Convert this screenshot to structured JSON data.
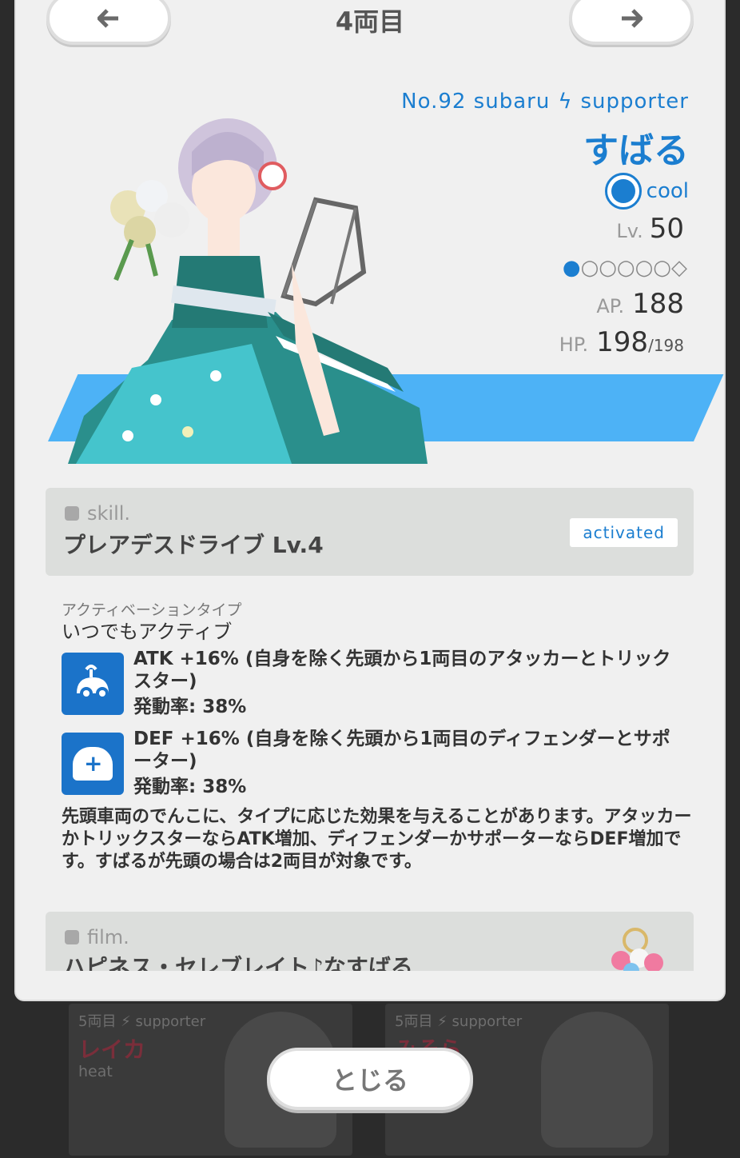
{
  "nav": {
    "prev_icon": "arrow-left-icon",
    "next_icon": "arrow-right-icon",
    "title": "4両目"
  },
  "character": {
    "id_line": "No.92 subaru",
    "role": "supporter",
    "name": "すばる",
    "attribute": "cool",
    "attribute_color": "#1b7ed0",
    "level_label": "Lv.",
    "level": "50",
    "rank_filled": "●",
    "rank_empty": "○○○○○◇",
    "ap_label": "AP.",
    "ap": "188",
    "hp_label": "HP.",
    "hp": "198",
    "hp_max": "/198",
    "stripe_color": "#4db2f6"
  },
  "skill": {
    "section_label": "skill.",
    "name": "プレアデスドライブ Lv.4",
    "status": "activated",
    "activation_type_label": "アクティベーションタイプ",
    "activation_type": "いつでもアクティブ",
    "effects": [
      {
        "icon": "attack-buff-icon",
        "text": "ATK +16% (自身を除く先頭から1両目のアタッカーとトリックスター)",
        "rate": "発動率: 38%"
      },
      {
        "icon": "defense-buff-icon",
        "text": "DEF +16% (自身を除く先頭から1両目のディフェンダーとサポーター)",
        "rate": "発動率: 38%"
      }
    ],
    "description": "先頭車両のでんこに、タイプに応じた効果を与えることがあります。アタッカーかトリックスターならATK増加、ディフェンダーかサポーターならDEF増加です。すばるが先頭の場合は2両目が対象です。"
  },
  "film": {
    "section_label": "film.",
    "name": "ハピネス・セレブレイト♪なすばる"
  },
  "background_cards": [
    {
      "meta": "5両目 ⚡ supporter",
      "name": "レイカ",
      "attribute": "heat"
    },
    {
      "meta": "5両目 ⚡ supporter",
      "name": "みそら"
    }
  ],
  "close_label": "とじる"
}
